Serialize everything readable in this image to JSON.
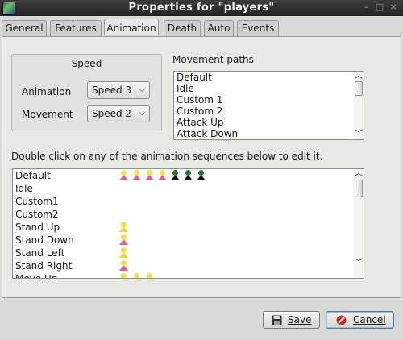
{
  "window": {
    "title": "Properties for \"players\""
  },
  "tabs": [
    {
      "label": "General",
      "active": false
    },
    {
      "label": "Features",
      "active": false
    },
    {
      "label": "Animation",
      "active": true
    },
    {
      "label": "Death",
      "active": false
    },
    {
      "label": "Auto",
      "active": false
    },
    {
      "label": "Events",
      "active": false
    }
  ],
  "speed": {
    "title": "Speed",
    "animation_label": "Animation",
    "animation_value": "Speed 3",
    "movement_label": "Movement",
    "movement_value": "Speed 2"
  },
  "movement_paths": {
    "label": "Movement paths",
    "items": [
      "Default",
      "Idle",
      "Custom 1",
      "Custom 2",
      "Attack Up",
      "Attack Down"
    ]
  },
  "sequences": {
    "instruction": "Double click on any of the animation sequences below to edit it.",
    "items": [
      {
        "name": "Default",
        "frames": [
          "pink",
          "pink",
          "pink",
          "pink",
          "black",
          "black",
          "black"
        ]
      },
      {
        "name": "Idle",
        "frames": []
      },
      {
        "name": "Custom1",
        "frames": []
      },
      {
        "name": "Custom2",
        "frames": []
      },
      {
        "name": "Stand Up",
        "frames": [
          "yellow"
        ]
      },
      {
        "name": "Stand Down",
        "frames": [
          "pink"
        ]
      },
      {
        "name": "Stand Left",
        "frames": [
          "yellow"
        ]
      },
      {
        "name": "Stand Right",
        "frames": [
          "pink"
        ]
      },
      {
        "name": "Move Up",
        "frames": [
          "yellow",
          "yellow",
          "yellow"
        ]
      }
    ]
  },
  "buttons": {
    "save": "Save",
    "cancel": "Cancel"
  },
  "icons": {
    "scroll_up": "chevron-up-icon",
    "scroll_down": "chevron-down-icon",
    "save": "floppy-disk-icon",
    "cancel": "cancel-icon"
  },
  "colors": {
    "frame_pink": "#e9559b",
    "frame_yellow": "#f0d81e",
    "frame_black": "#111111",
    "focus": "#4a79b8"
  }
}
